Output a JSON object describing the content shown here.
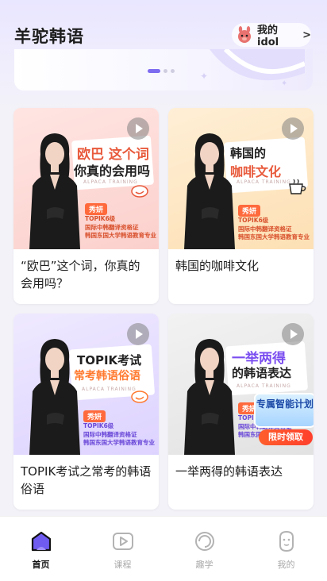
{
  "app": {
    "title": "羊驼韩语"
  },
  "header": {
    "idol_label": "我的idol",
    "idol_chevron": ">"
  },
  "banner": {
    "dots": 3,
    "active_dot": 0
  },
  "cards": [
    {
      "title": "“欧巴”这个词，你真的会用吗？",
      "thumb": {
        "line1": "欧巴 这个词",
        "line2": "你真的会用吗",
        "sub": "ALPACA TRAINING",
        "teacher": "秀妍",
        "cred": [
          "TOPIK6级",
          "国际中韩翻译资格证",
          "韩国东国大学韩语教育专业"
        ],
        "bg": "#fde3e0"
      }
    },
    {
      "title": "韩国的咖啡文化",
      "thumb": {
        "line1": "韩国的",
        "line2": "咖啡文化",
        "sub": "ALPACA TRAINING",
        "teacher": "秀妍",
        "cred": [
          "TOPIK6级",
          "国际中韩翻译资格证",
          "韩国东国大学韩语教育专业"
        ],
        "bg": "#fde8c8"
      }
    },
    {
      "title": "TOPIK考试之常考的韩语俗语",
      "thumb": {
        "line1": "TOPIK考试",
        "line2": "常考韩语俗语",
        "sub": "ALPACA TRAINING",
        "teacher": "秀妍",
        "cred": [
          "TOPIK6级",
          "国际中韩翻译资格证",
          "韩国东国大学韩语教育专业"
        ],
        "bg": "#ece6ff"
      }
    },
    {
      "title": "一举两得的韩语表达",
      "thumb": {
        "line1": "一举两得",
        "line2": "的韩语表达",
        "sub": "ALPACA TRAINING",
        "teacher": "秀妍",
        "cred": [
          "TOPIK6级",
          "国际中韩翻译资格证",
          "韩国东国大学韩语教育专业"
        ],
        "bg": "#ececec"
      }
    }
  ],
  "promo": {
    "title": "专属智能计划",
    "button": "限时领取"
  },
  "tabs": [
    {
      "label": "首页",
      "icon": "home-icon",
      "active": true
    },
    {
      "label": "课程",
      "icon": "course-play-icon",
      "active": false
    },
    {
      "label": "趣学",
      "icon": "fun-learn-icon",
      "active": false
    },
    {
      "label": "我的",
      "icon": "profile-alpaca-icon",
      "active": false
    }
  ],
  "colors": {
    "accent": "#7d6cf0",
    "orange": "#ff6a3d",
    "purple_text": "#7a4df0"
  }
}
